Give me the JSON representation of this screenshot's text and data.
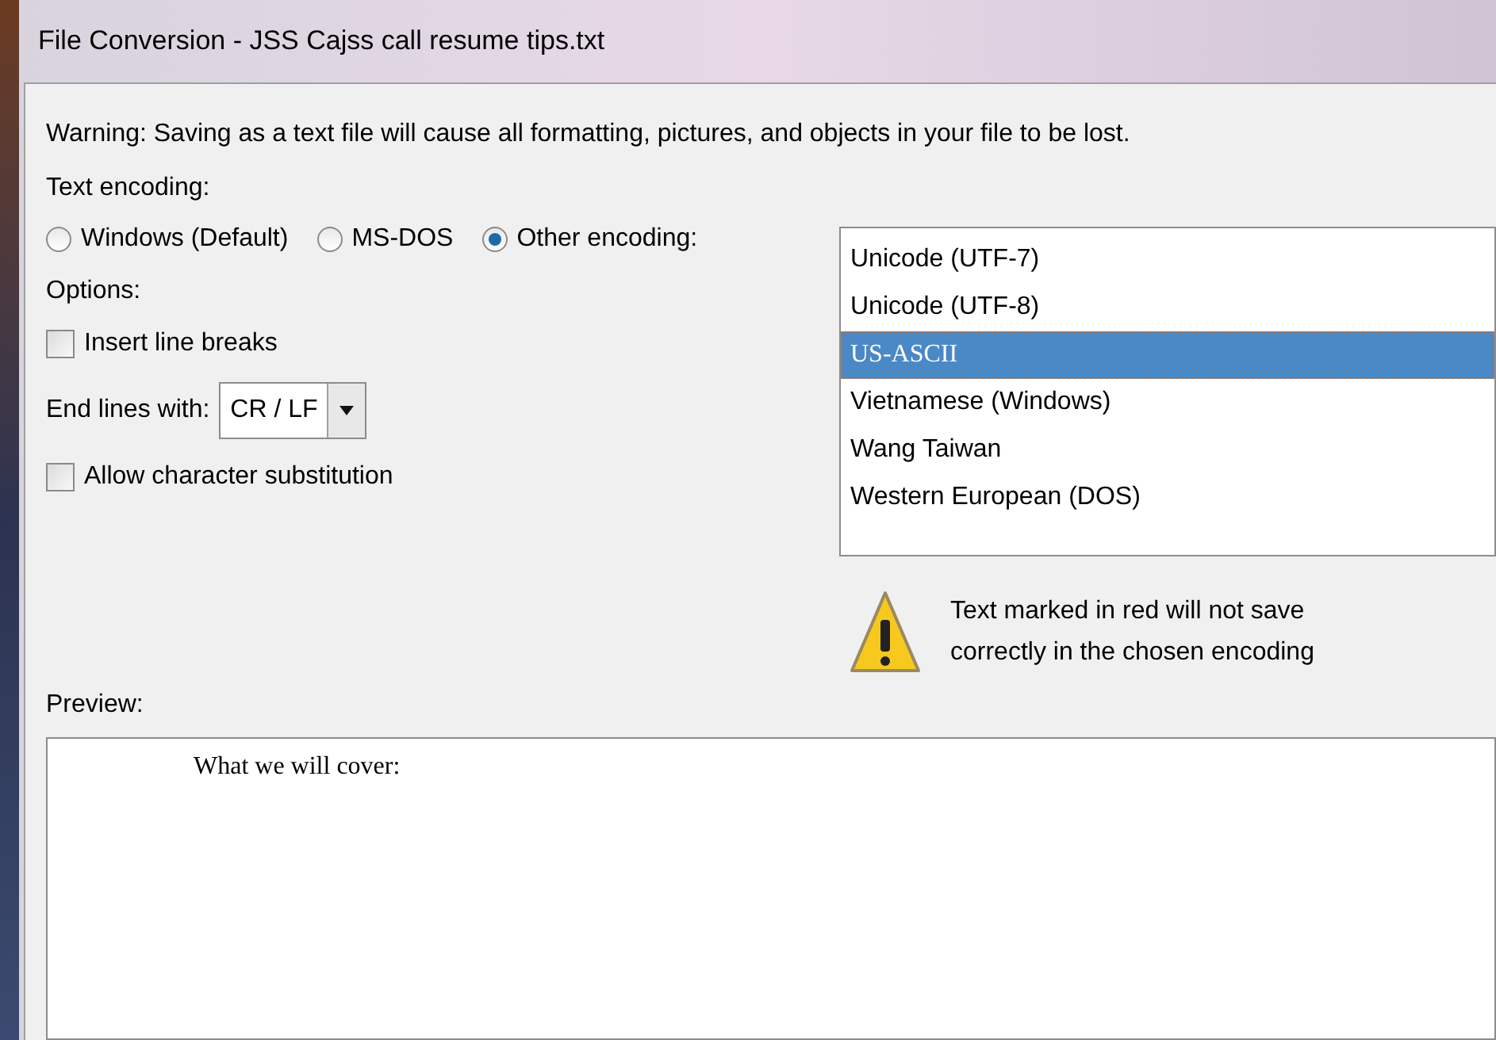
{
  "window": {
    "title": "File Conversion - JSS Cajss call resume tips.txt"
  },
  "warning": "Warning: Saving as a text file will cause all formatting, pictures, and objects in your file to be lost.",
  "text_encoding_label": "Text encoding:",
  "encodings": [
    {
      "label": "Windows (Default)",
      "selected": false
    },
    {
      "label": "MS-DOS",
      "selected": false
    },
    {
      "label": "Other encoding:",
      "selected": true
    }
  ],
  "options_label": "Options:",
  "options": [
    {
      "kind": "checkbox",
      "label": "Insert line breaks",
      "checked": false
    },
    {
      "kind": "dropdown",
      "label": "End lines with:",
      "value": "CR / LF"
    },
    {
      "kind": "checkbox",
      "label": "Allow character substitution",
      "checked": false
    }
  ],
  "encoding_list": [
    {
      "label": "Unicode (UTF-7)",
      "selected": false
    },
    {
      "label": "Unicode (UTF-8)",
      "selected": false
    },
    {
      "label": "US-ASCII",
      "selected": true
    },
    {
      "label": "Vietnamese (Windows)",
      "selected": false
    },
    {
      "label": "Wang Taiwan",
      "selected": false
    },
    {
      "label": "Western European (DOS)",
      "selected": false
    }
  ],
  "note": "Text marked in red will not save correctly in the chosen encoding",
  "preview_label": "Preview:",
  "preview_text": "What we will cover:"
}
